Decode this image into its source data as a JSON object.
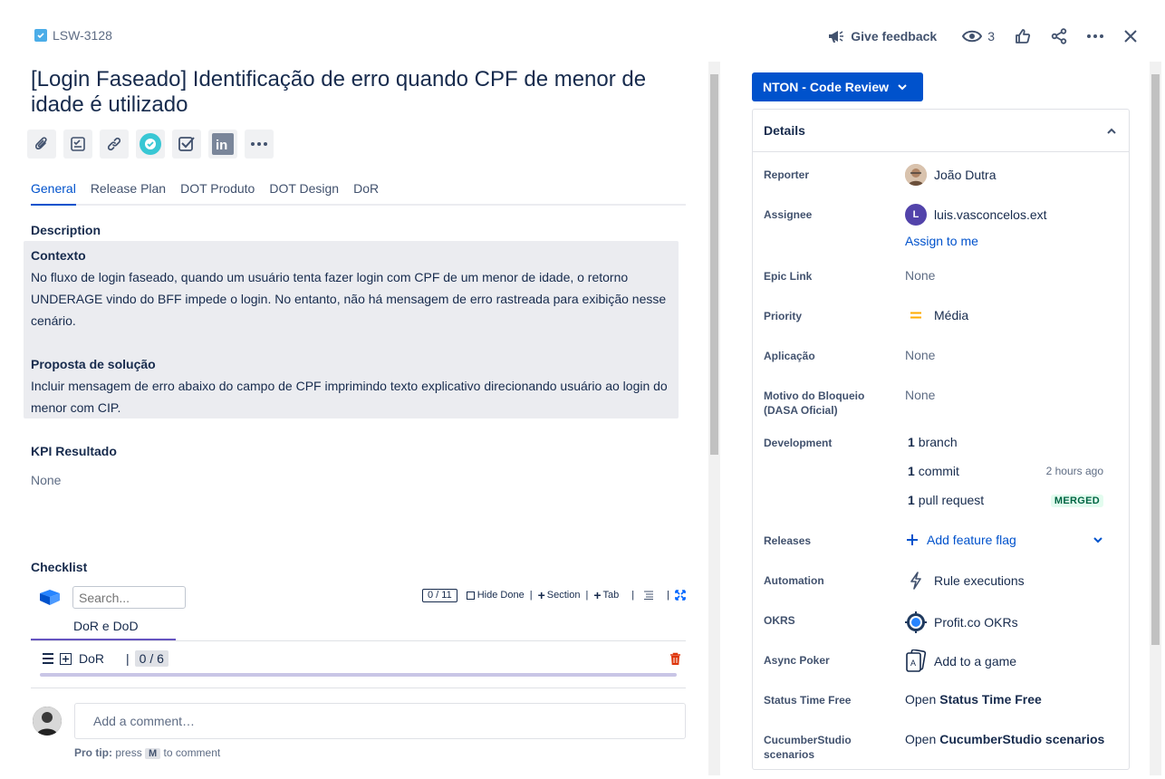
{
  "header": {
    "issue_key": "LSW-3128",
    "give_feedback": "Give feedback",
    "watchers": "3"
  },
  "issue": {
    "title": "[Login Faseado] Identificação de erro quando CPF de menor de idade é utilizado"
  },
  "tabs": [
    "General",
    "Release Plan",
    "DOT Produto",
    "DOT Design",
    "DoR"
  ],
  "description": {
    "heading": "Description",
    "context_heading": "Contexto",
    "context_text": "No fluxo de login faseado, quando um usuário tenta fazer login com CPF de um menor de idade, o retorno UNDERAGE vindo do BFF impede o login. No entanto, não há mensagem de erro rastreada para exibição nesse cenário.",
    "solution_heading": "Proposta de solução",
    "solution_text": "Incluir mensagem de erro abaixo do campo de CPF imprimindo texto explicativo direcionando usuário ao login do menor com CIP."
  },
  "kpi": {
    "heading": "KPI Resultado",
    "value": "None"
  },
  "checklist": {
    "heading": "Checklist",
    "search_placeholder": "Search...",
    "count": "0 / 11",
    "hide_done": "Hide Done",
    "section": "Section",
    "tab": "Tab",
    "tab_name": "DoR e DoD",
    "row_name": "DoR",
    "row_count": "0 / 6"
  },
  "comment": {
    "placeholder": "Add a comment…",
    "protip_prefix": "Pro tip:",
    "protip_press": "press",
    "protip_key": "M",
    "protip_suffix": "to comment"
  },
  "status": {
    "label": "NTON - Code Review",
    "color": "#0052cc"
  },
  "details": {
    "heading": "Details",
    "reporter_label": "Reporter",
    "reporter": "João Dutra",
    "assignee_label": "Assignee",
    "assignee": "luis.vasconcelos.ext",
    "assignee_initial": "L",
    "assign_to_me": "Assign to me",
    "epic_label": "Epic Link",
    "epic": "None",
    "priority_label": "Priority",
    "priority": "Média",
    "aplicacao_label": "Aplicação",
    "aplicacao": "None",
    "motivo_label": "Motivo do Bloqueio (DASA Oficial)",
    "motivo": "None",
    "development_label": "Development",
    "dev_branch_count": "1",
    "dev_branch": "branch",
    "dev_commit_count": "1",
    "dev_commit": "commit",
    "dev_commit_time": "2 hours ago",
    "dev_pr_count": "1",
    "dev_pr": "pull request",
    "dev_pr_status": "MERGED",
    "releases_label": "Releases",
    "releases": "Add feature flag",
    "automation_label": "Automation",
    "automation": "Rule executions",
    "okrs_label": "OKRS",
    "okrs": "Profit.co OKRs",
    "poker_label": "Async Poker",
    "poker": "Add to a game",
    "status_time_label": "Status Time Free",
    "status_time_prefix": "Open",
    "status_time": "Status Time Free",
    "cucumber_label": "CucumberStudio scenarios",
    "cucumber_prefix": "Open",
    "cucumber": "CucumberStudio scenarios"
  }
}
